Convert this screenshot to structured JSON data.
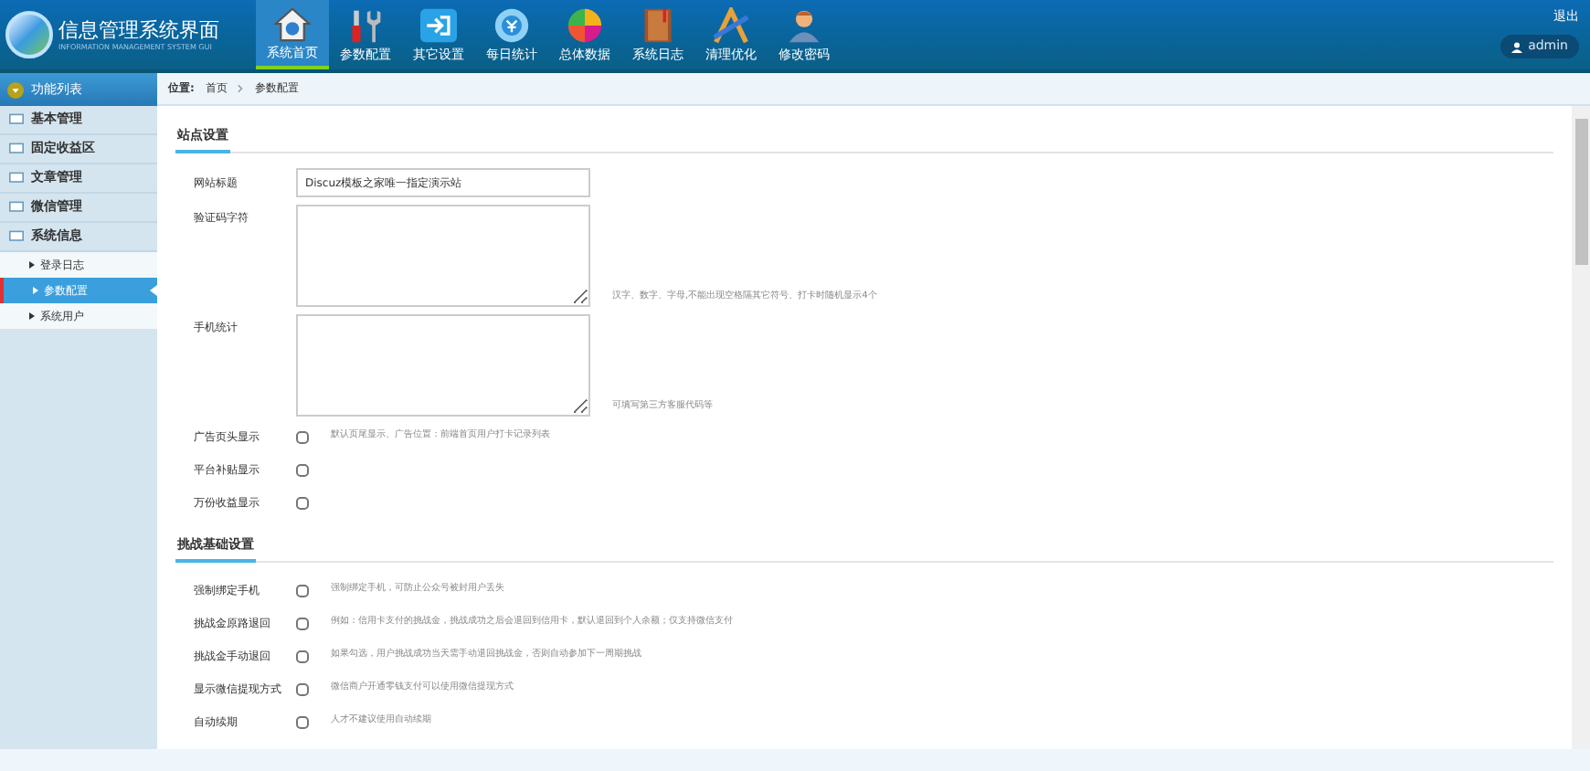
{
  "header": {
    "logo_text": "信息管理系统界面",
    "logo_subtext": "INFORMATION MANAGEMENT SYSTEM GUI",
    "logout": "退出",
    "user": "admin"
  },
  "nav": [
    {
      "label": "系统首页",
      "kind": "home",
      "selected": true
    },
    {
      "label": "参数配置",
      "kind": "tools",
      "selected": false
    },
    {
      "label": "其它设置",
      "kind": "exit",
      "selected": false
    },
    {
      "label": "每日统计",
      "kind": "coin",
      "selected": false
    },
    {
      "label": "总体数据",
      "kind": "pie",
      "selected": false
    },
    {
      "label": "系统日志",
      "kind": "book",
      "selected": false
    },
    {
      "label": "清理优化",
      "kind": "ruler",
      "selected": false
    },
    {
      "label": "修改密码",
      "kind": "person",
      "selected": false
    }
  ],
  "sidebar": {
    "title": "功能列表",
    "items": [
      {
        "label": "基本管理"
      },
      {
        "label": "固定收益区"
      },
      {
        "label": "文章管理"
      },
      {
        "label": "微信管理"
      },
      {
        "label": "系统信息",
        "children": [
          {
            "label": "登录日志",
            "selected": false
          },
          {
            "label": "参数配置",
            "selected": true
          },
          {
            "label": "系统用户",
            "selected": false
          }
        ]
      }
    ]
  },
  "breadcrumb": {
    "label": "位置:",
    "items": [
      "首页",
      "参数配置"
    ]
  },
  "sections": [
    {
      "title": "站点设置",
      "rows": [
        {
          "kind": "text",
          "label": "网站标题",
          "value": "Discuz模板之家唯一指定演示站"
        },
        {
          "kind": "textarea",
          "label": "验证码字符",
          "value": "",
          "hint": "汉字、数字、字母,不能出现空格隔其它符号、打卡时随机显示4个"
        },
        {
          "kind": "textarea",
          "label": "手机统计",
          "value": "",
          "hint": "可填写第三方客服代码等"
        },
        {
          "kind": "checkbox",
          "label": "广告页头显示",
          "checked": false,
          "hint": "默认页尾显示、广告位置：前端首页用户打卡记录列表"
        },
        {
          "kind": "checkbox",
          "label": "平台补贴显示",
          "checked": false
        },
        {
          "kind": "checkbox",
          "label": "万份收益显示",
          "checked": false
        }
      ]
    },
    {
      "title": "挑战基础设置",
      "rows": [
        {
          "kind": "checkbox",
          "label": "强制绑定手机",
          "checked": false,
          "hint": "强制绑定手机，可防止公众号被封用户丢失"
        },
        {
          "kind": "checkbox",
          "label": "挑战金原路退回",
          "checked": false,
          "hint": "例如：信用卡支付的挑战金，挑战成功之后会退回到信用卡，默认退回到个人余额；仅支持微信支付"
        },
        {
          "kind": "checkbox",
          "label": "挑战金手动退回",
          "checked": false,
          "hint": "如果勾选，用户挑战成功当天需手动退回挑战金，否则自动参加下一周期挑战"
        },
        {
          "kind": "checkbox",
          "label": "显示微信提现方式",
          "checked": false,
          "hint": "微信商户开通零钱支付可以使用微信提现方式"
        },
        {
          "kind": "checkbox",
          "label": "自动续期",
          "checked": false,
          "hint": "人才不建议使用自动续期"
        }
      ]
    }
  ]
}
